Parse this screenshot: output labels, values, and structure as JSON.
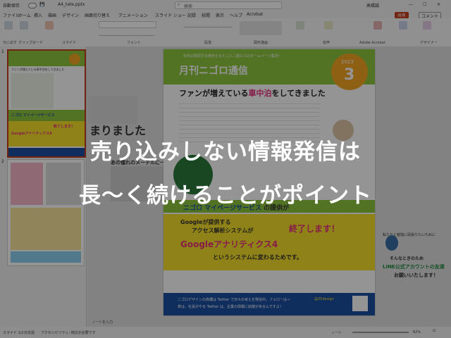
{
  "titlebar": {
    "autosave": "自動保存",
    "filename": "A4_tate.pptx",
    "search": "検索",
    "user": "高橋誠"
  },
  "ribbon_tabs": [
    "ファイル",
    "ホーム",
    "挿入",
    "描画",
    "デザイン",
    "画面切り替え",
    "アニメーション",
    "スライド ショー",
    "記録",
    "校閲",
    "表示",
    "ヘルプ",
    "Acrobat"
  ],
  "ribbon_groups": [
    "元に戻す",
    "クリップボード",
    "スライド",
    "フォント",
    "段落",
    "図形描画",
    "音声",
    "Adobe Acrobat",
    "デザイナー"
  ],
  "share_label": "共有",
  "comment_label": "コメント",
  "slide_nums": [
    "1",
    "2"
  ],
  "slide": {
    "header_small": "日代の質問する表示士ると二人二組ロゴのホームページ集活！",
    "title": "月刊ニゴロ通信",
    "issue_label": "2023",
    "issue_number": "3",
    "headline_pre": "ファンが増えている",
    "headline_red": "車中泊",
    "headline_post": "をしてきました",
    "service_prefix": "ニゴロ",
    "service_name": "マイページサービス",
    "service_suffix": "の提供が",
    "ga_line1": "Googleが提供する",
    "ga_line2": "アクセス解析システムが",
    "ga_end": "終了します！",
    "ga4_name": "Googleアナリティクス4",
    "ga_replace": "というシステムに変わるためです。",
    "footer_line1": "ニゴロデザインの高橋は Twitter で日々の考えを発信中。フォローは→",
    "footer_handle": "@25design",
    "footer_line2": "表は、社長がやる Twitter は、企業の情報に拡散があるんですよ！",
    "side_text1": "私たちと勉強に頑張りたいために",
    "side_text2": "そんなときのため",
    "side_line": "LINE公式アカウントの友達",
    "side_line2": "お願いいたします！"
  },
  "thumb_text": {
    "t1_head": "ファンが増えている車中泊をしてきました",
    "t1_service": "ニゴロ マイページサービス",
    "t1_ga": "Googleアナリティクス4",
    "t1_end": "終了します！",
    "t2_big": "まりました",
    "t2_lede": "あの憧れのメーデルに一？！"
  },
  "status": {
    "slide_info": "スライド 1/2",
    "lang": "日本語",
    "accessibility": "アクセシビリティ: 検討が必要です",
    "notes": "ノートを入力",
    "notes_btn": "ノート",
    "zoom": "62%"
  },
  "caption": {
    "line1": "売り込みしない情報発信は",
    "line2": "長〜く続けることがポイント"
  },
  "colors": {
    "accent": "#c43e1c",
    "green": "#8dc63f",
    "orange": "#f5a623",
    "pink": "#e8317d",
    "blue": "#1a4fa0",
    "yellow": "#f7e12a"
  }
}
